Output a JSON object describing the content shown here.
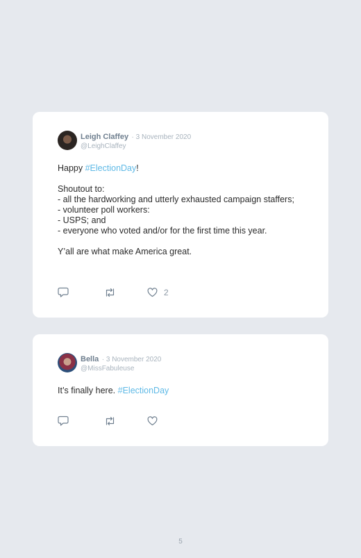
{
  "tweets": [
    {
      "name": "Leigh Claffey",
      "date": "· 3 November 2020",
      "handle": "@LeighClaffey",
      "line1_pre": "Happy ",
      "line1_tag": "#ElectionDay",
      "line1_post": "!",
      "line2": "Shoutout to:",
      "line3": "- all the hardworking and utterly exhausted campaign staffers;",
      "line4": "- volunteer poll workers:",
      "line5": "- USPS; and",
      "line6": "- everyone who voted and/or for the first time this year.",
      "line7": "Y’all are what make America great.",
      "likes": "2",
      "avatar_icon": "profile-photo-icon"
    },
    {
      "name": "Bella",
      "date": "· 3 November 2020",
      "handle": "@MissFabuleuse",
      "line1_pre": "It’s finally here. ",
      "line1_tag": "#ElectionDay",
      "avatar_icon": "profile-photo-icon"
    }
  ],
  "icons": {
    "reply": "reply-icon",
    "retweet": "retweet-icon",
    "like": "heart-icon"
  },
  "colors": {
    "background": "#e6e9ee",
    "card": "#ffffff",
    "hashtag": "#5eb9e6",
    "name": "#6f7f8f",
    "muted": "#a8b3bd"
  },
  "page_number": "5"
}
